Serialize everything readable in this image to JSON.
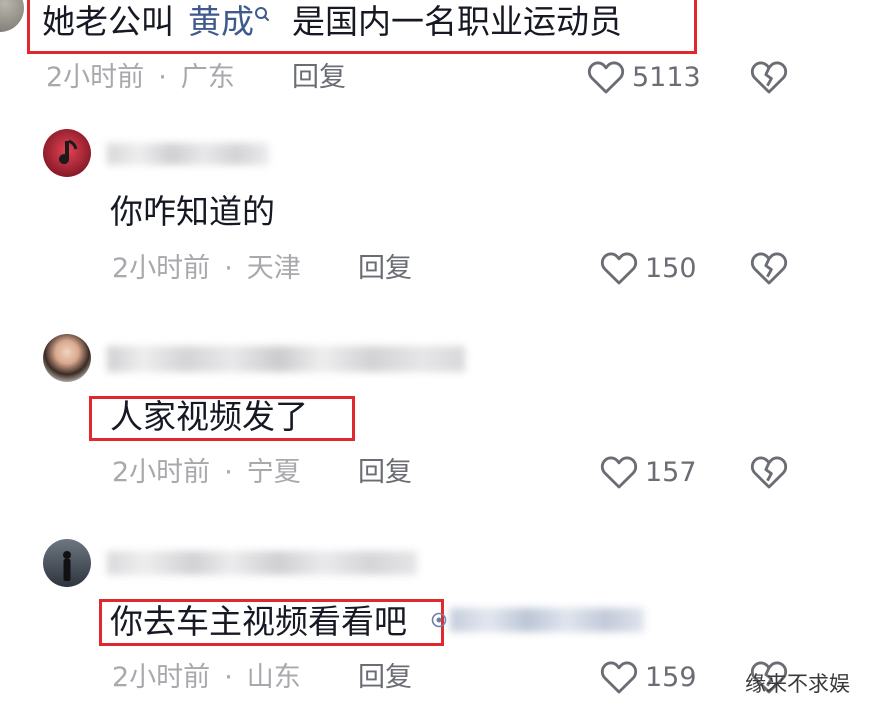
{
  "comments": [
    {
      "text_before": "她老公叫",
      "mention": "黄成",
      "text_after": "是国内一名职业运动员",
      "time": "2小时前",
      "sep": "·",
      "location": "广东",
      "reply_label": "回复",
      "likes": "5113"
    },
    {
      "text": "你咋知道的",
      "time": "2小时前",
      "sep": "·",
      "location": "天津",
      "reply_label": "回复",
      "likes": "150"
    },
    {
      "text": "人家视频发了",
      "time": "2小时前",
      "sep": "·",
      "location": "宁夏",
      "reply_label": "回复",
      "likes": "157"
    },
    {
      "text": "你去车主视频看看吧",
      "time": "2小时前",
      "sep": "·",
      "location": "山东",
      "reply_label": "回复",
      "likes": "159"
    }
  ],
  "watermark": "缘来不求娱",
  "colors": {
    "highlight": "#e0282e",
    "mention": "#3f5b8d",
    "meta": "#a8a9ad"
  },
  "icons": [
    "search-mini-icon",
    "heart-outline-icon",
    "broken-heart-icon"
  ]
}
